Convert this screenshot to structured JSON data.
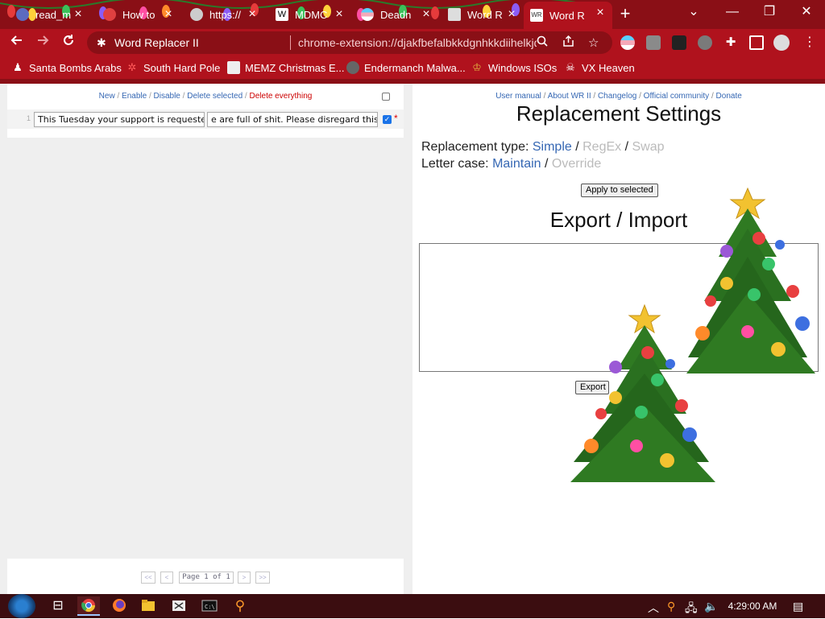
{
  "browser": {
    "tabs": [
      {
        "title": "read_m"
      },
      {
        "title": "How to"
      },
      {
        "title": "https://"
      },
      {
        "title": "MDMC"
      },
      {
        "title": "Deadn"
      },
      {
        "title": "Word R"
      },
      {
        "title": "Word R",
        "active": true
      }
    ],
    "new_tab": "+",
    "window_controls": {
      "tabsearch": "⌄",
      "minimize": "—",
      "restore": "❐",
      "close": "✕"
    }
  },
  "toolbar": {
    "site_name": "Word Replacer II",
    "url": "chrome-extension://djakfbefalbkkdgnhkkdiihelkjdpbfh/option..."
  },
  "bookmarks": [
    {
      "label": "Santa Bombs Arabs"
    },
    {
      "label": "South Hard Pole"
    },
    {
      "label": "MEMZ Christmas E..."
    },
    {
      "label": "Endermanch Malwa..."
    },
    {
      "label": "Windows ISOs"
    },
    {
      "label": "VX Heaven"
    }
  ],
  "left_panel": {
    "actions": {
      "new": "New",
      "enable": "Enable",
      "disable": "Disable",
      "delete_selected": "Delete selected",
      "delete_everything": "Delete everything",
      "sep": " / "
    },
    "row": {
      "number": "1",
      "find": "This Tuesday your support is requeste",
      "replace": "e are full of shit. Please disregard this"
    },
    "pager": {
      "first": "<<",
      "prev": "<",
      "label": "Page 1 of 1",
      "next": ">",
      "last": ">>"
    }
  },
  "right_panel": {
    "links": {
      "manual": "User manual",
      "about": "About WR II",
      "changelog": "Changelog",
      "community": "Official community",
      "donate": "Donate",
      "sep": " / "
    },
    "title": "Replacement Settings",
    "replacement_type": {
      "label": "Replacement type:",
      "simple": "Simple",
      "regex": "RegEx",
      "swap": "Swap",
      "sep": " / "
    },
    "letter_case": {
      "label": "Letter case:",
      "maintain": "Maintain",
      "override": "Override",
      "sep": " / "
    },
    "apply_button": "Apply to selected",
    "export_title": "Export / Import",
    "export_button": "Export"
  },
  "taskbar": {
    "clock": "4:29:00 AM"
  },
  "colors": {
    "chrome_dark": "#8a0f16",
    "chrome": "#b0121d",
    "link": "#3567b3",
    "danger": "#cc0000"
  }
}
